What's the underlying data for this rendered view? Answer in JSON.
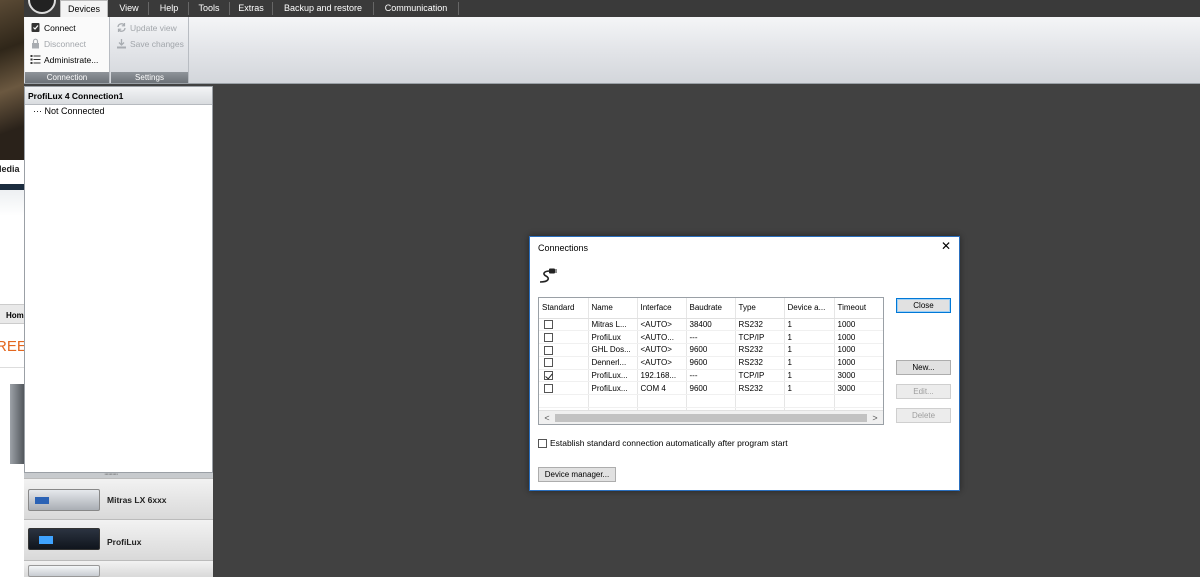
{
  "menubar": {
    "tabs": [
      {
        "label": "Devices",
        "active": true
      },
      {
        "label": "View"
      },
      {
        "label": "Help"
      },
      {
        "label": "Tools"
      },
      {
        "label": "Extras"
      },
      {
        "label": "Backup and restore"
      },
      {
        "label": "Communication"
      }
    ]
  },
  "ribbon": {
    "connection_group": {
      "label": "Connection",
      "connect": "Connect",
      "disconnect": "Disconnect",
      "administrate": "Administrate..."
    },
    "settings_group": {
      "label": "Settings",
      "update_view": "Update view",
      "save_changes": "Save changes"
    }
  },
  "left_strip": {
    "media_text": "Media",
    "home_text": "Hom",
    "promo_text": "REE"
  },
  "tree": {
    "title": "ProfiLux 4 Connection1",
    "item": "··· Not Connected"
  },
  "splitter_dots": "··········",
  "devices": [
    {
      "name": "Mitras LX 6xxx"
    },
    {
      "name": "ProfiLux"
    }
  ],
  "dialog": {
    "title": "Connections",
    "close_glyph": "✕",
    "columns": [
      "Standard",
      "Name",
      "Interface",
      "Baudrate",
      "Type",
      "Device a...",
      "Timeout"
    ],
    "rows": [
      {
        "standard": false,
        "name": "Mitras L...",
        "interface": "<AUTO>",
        "baudrate": "38400",
        "type": "RS232",
        "device": "1",
        "timeout": "1000"
      },
      {
        "standard": false,
        "name": "ProfiLux",
        "interface": "<AUTO...",
        "baudrate": "---",
        "type": "TCP/IP",
        "device": "1",
        "timeout": "1000"
      },
      {
        "standard": false,
        "name": "GHL Dos...",
        "interface": "<AUTO>",
        "baudrate": "9600",
        "type": "RS232",
        "device": "1",
        "timeout": "1000"
      },
      {
        "standard": false,
        "name": "Dennerl...",
        "interface": "<AUTO>",
        "baudrate": "9600",
        "type": "RS232",
        "device": "1",
        "timeout": "1000"
      },
      {
        "standard": true,
        "name": "ProfiLux...",
        "interface": "192.168...",
        "baudrate": "---",
        "type": "TCP/IP",
        "device": "1",
        "timeout": "3000"
      },
      {
        "standard": false,
        "name": "ProfiLux...",
        "interface": "COM 4",
        "baudrate": "9600",
        "type": "RS232",
        "device": "1",
        "timeout": "3000"
      }
    ],
    "scroll_left": "<",
    "scroll_right": ">",
    "buttons": {
      "close": "Close",
      "new": "New...",
      "edit": "Edit...",
      "delete": "Delete",
      "device_manager": "Device manager..."
    },
    "auto_connect_label": "Establish standard connection automatically after program start",
    "auto_connect_checked": false
  }
}
